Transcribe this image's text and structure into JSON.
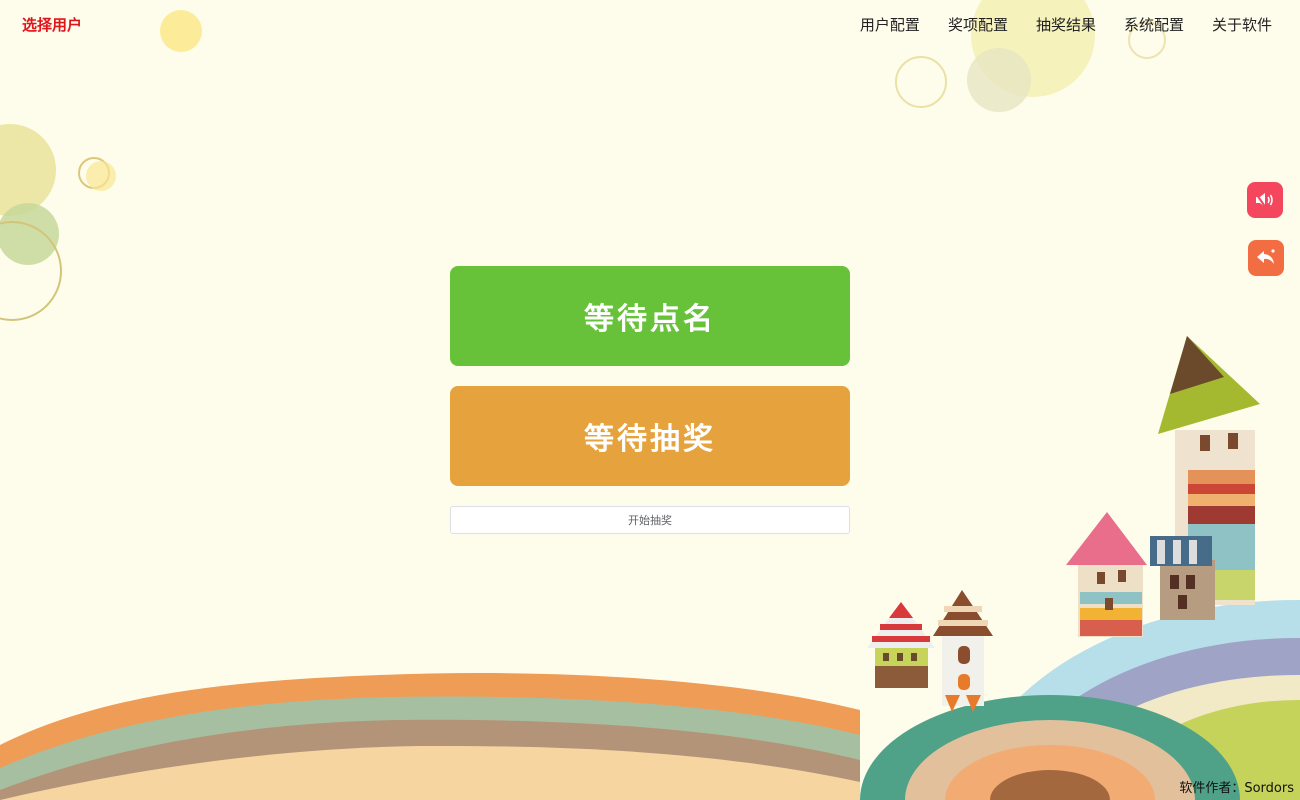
{
  "header": {
    "brand_label": "选择用户",
    "nav": [
      "用户配置",
      "奖项配置",
      "抽奖结果",
      "系统配置",
      "关于软件"
    ]
  },
  "main": {
    "rollcall_label": "等待点名",
    "lottery_label": "等待抽奖",
    "start_label": "开始抽奖"
  },
  "side": {
    "mute_icon": "speaker-muted-icon",
    "back_icon": "reply-icon"
  },
  "footer": {
    "author": "软件作者：Sordors"
  },
  "colors": {
    "background": "#fefdec",
    "rollcall": "#67c23a",
    "lottery": "#e6a23c",
    "brand": "#e0151b",
    "mute": "#f4475e",
    "back": "#f36d43"
  }
}
